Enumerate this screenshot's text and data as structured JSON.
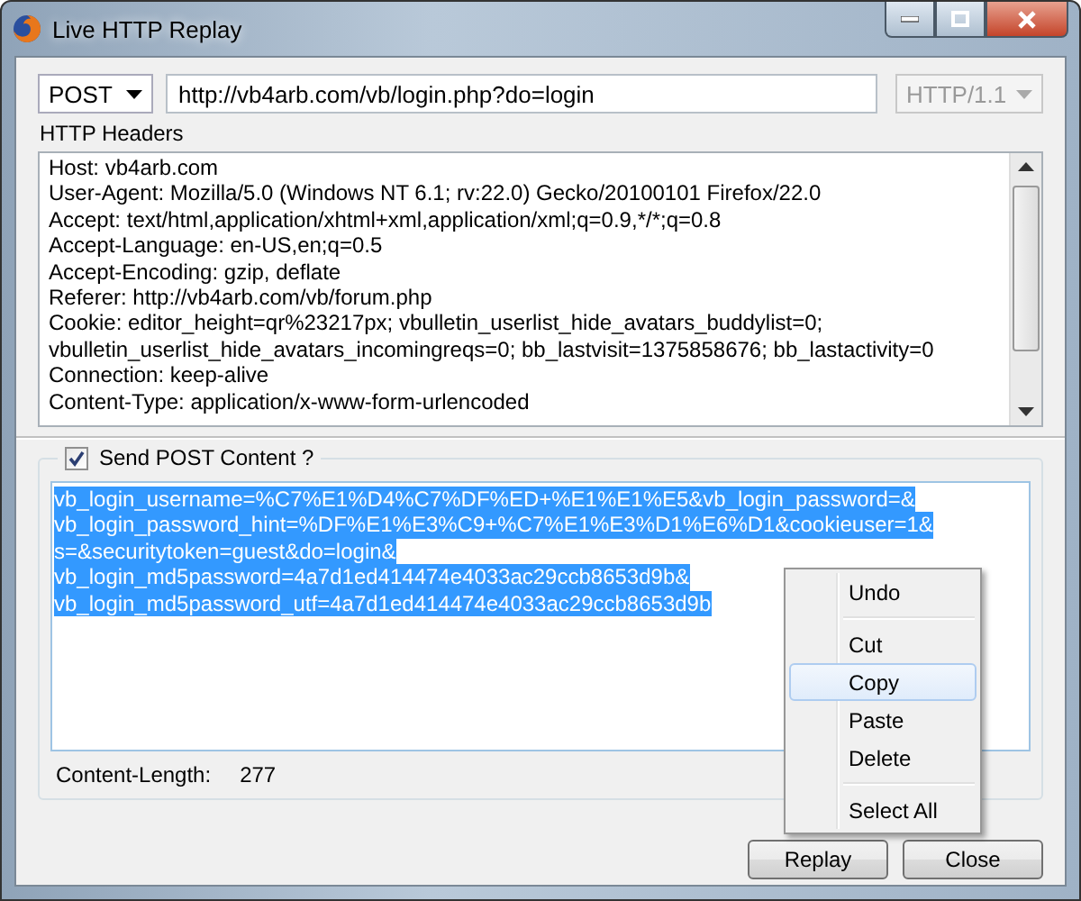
{
  "window": {
    "title": "Live HTTP Replay"
  },
  "request": {
    "method": "POST",
    "url": "http://vb4arb.com/vb/login.php?do=login",
    "version": "HTTP/1.1",
    "version_disabled": true
  },
  "headers": {
    "label": "HTTP Headers",
    "lines": [
      "Host: vb4arb.com",
      "User-Agent: Mozilla/5.0 (Windows NT 6.1; rv:22.0) Gecko/20100101 Firefox/22.0",
      "Accept: text/html,application/xhtml+xml,application/xml;q=0.9,*/*;q=0.8",
      "Accept-Language: en-US,en;q=0.5",
      "Accept-Encoding: gzip, deflate",
      "Referer: http://vb4arb.com/vb/forum.php",
      "Cookie: editor_height=qr%23217px; vbulletin_userlist_hide_avatars_buddylist=0;",
      "vbulletin_userlist_hide_avatars_incomingreqs=0; bb_lastvisit=1375858676; bb_lastactivity=0",
      "Connection: keep-alive",
      "Content-Type: application/x-www-form-urlencoded"
    ]
  },
  "post": {
    "label": "Send POST Content ?",
    "checked": true,
    "selected": true,
    "lines": [
      "vb_login_username=%C7%E1%D4%C7%DF%ED+%E1%E1%E5&vb_login_password=&",
      "vb_login_password_hint=%DF%E1%E3%C9+%C7%E1%E3%D1%E6%D1&cookieuser=1&",
      "s=&securitytoken=guest&do=login&",
      "vb_login_md5password=4a7d1ed414474e4033ac29ccb8653d9b&",
      "vb_login_md5password_utf=4a7d1ed414474e4033ac29ccb8653d9b"
    ],
    "length_label": "Content-Length:",
    "length_value": "277"
  },
  "buttons": [
    "Replay",
    "Close"
  ],
  "context_menu": [
    {
      "kind": "item",
      "label": "Undo",
      "selected": false
    },
    {
      "kind": "separator"
    },
    {
      "kind": "item",
      "label": "Cut",
      "selected": false
    },
    {
      "kind": "item",
      "label": "Copy",
      "selected": true
    },
    {
      "kind": "item",
      "label": "Paste",
      "selected": false
    },
    {
      "kind": "item",
      "label": "Delete",
      "selected": false
    },
    {
      "kind": "separator"
    },
    {
      "kind": "item",
      "label": "Select All",
      "selected": false
    }
  ]
}
